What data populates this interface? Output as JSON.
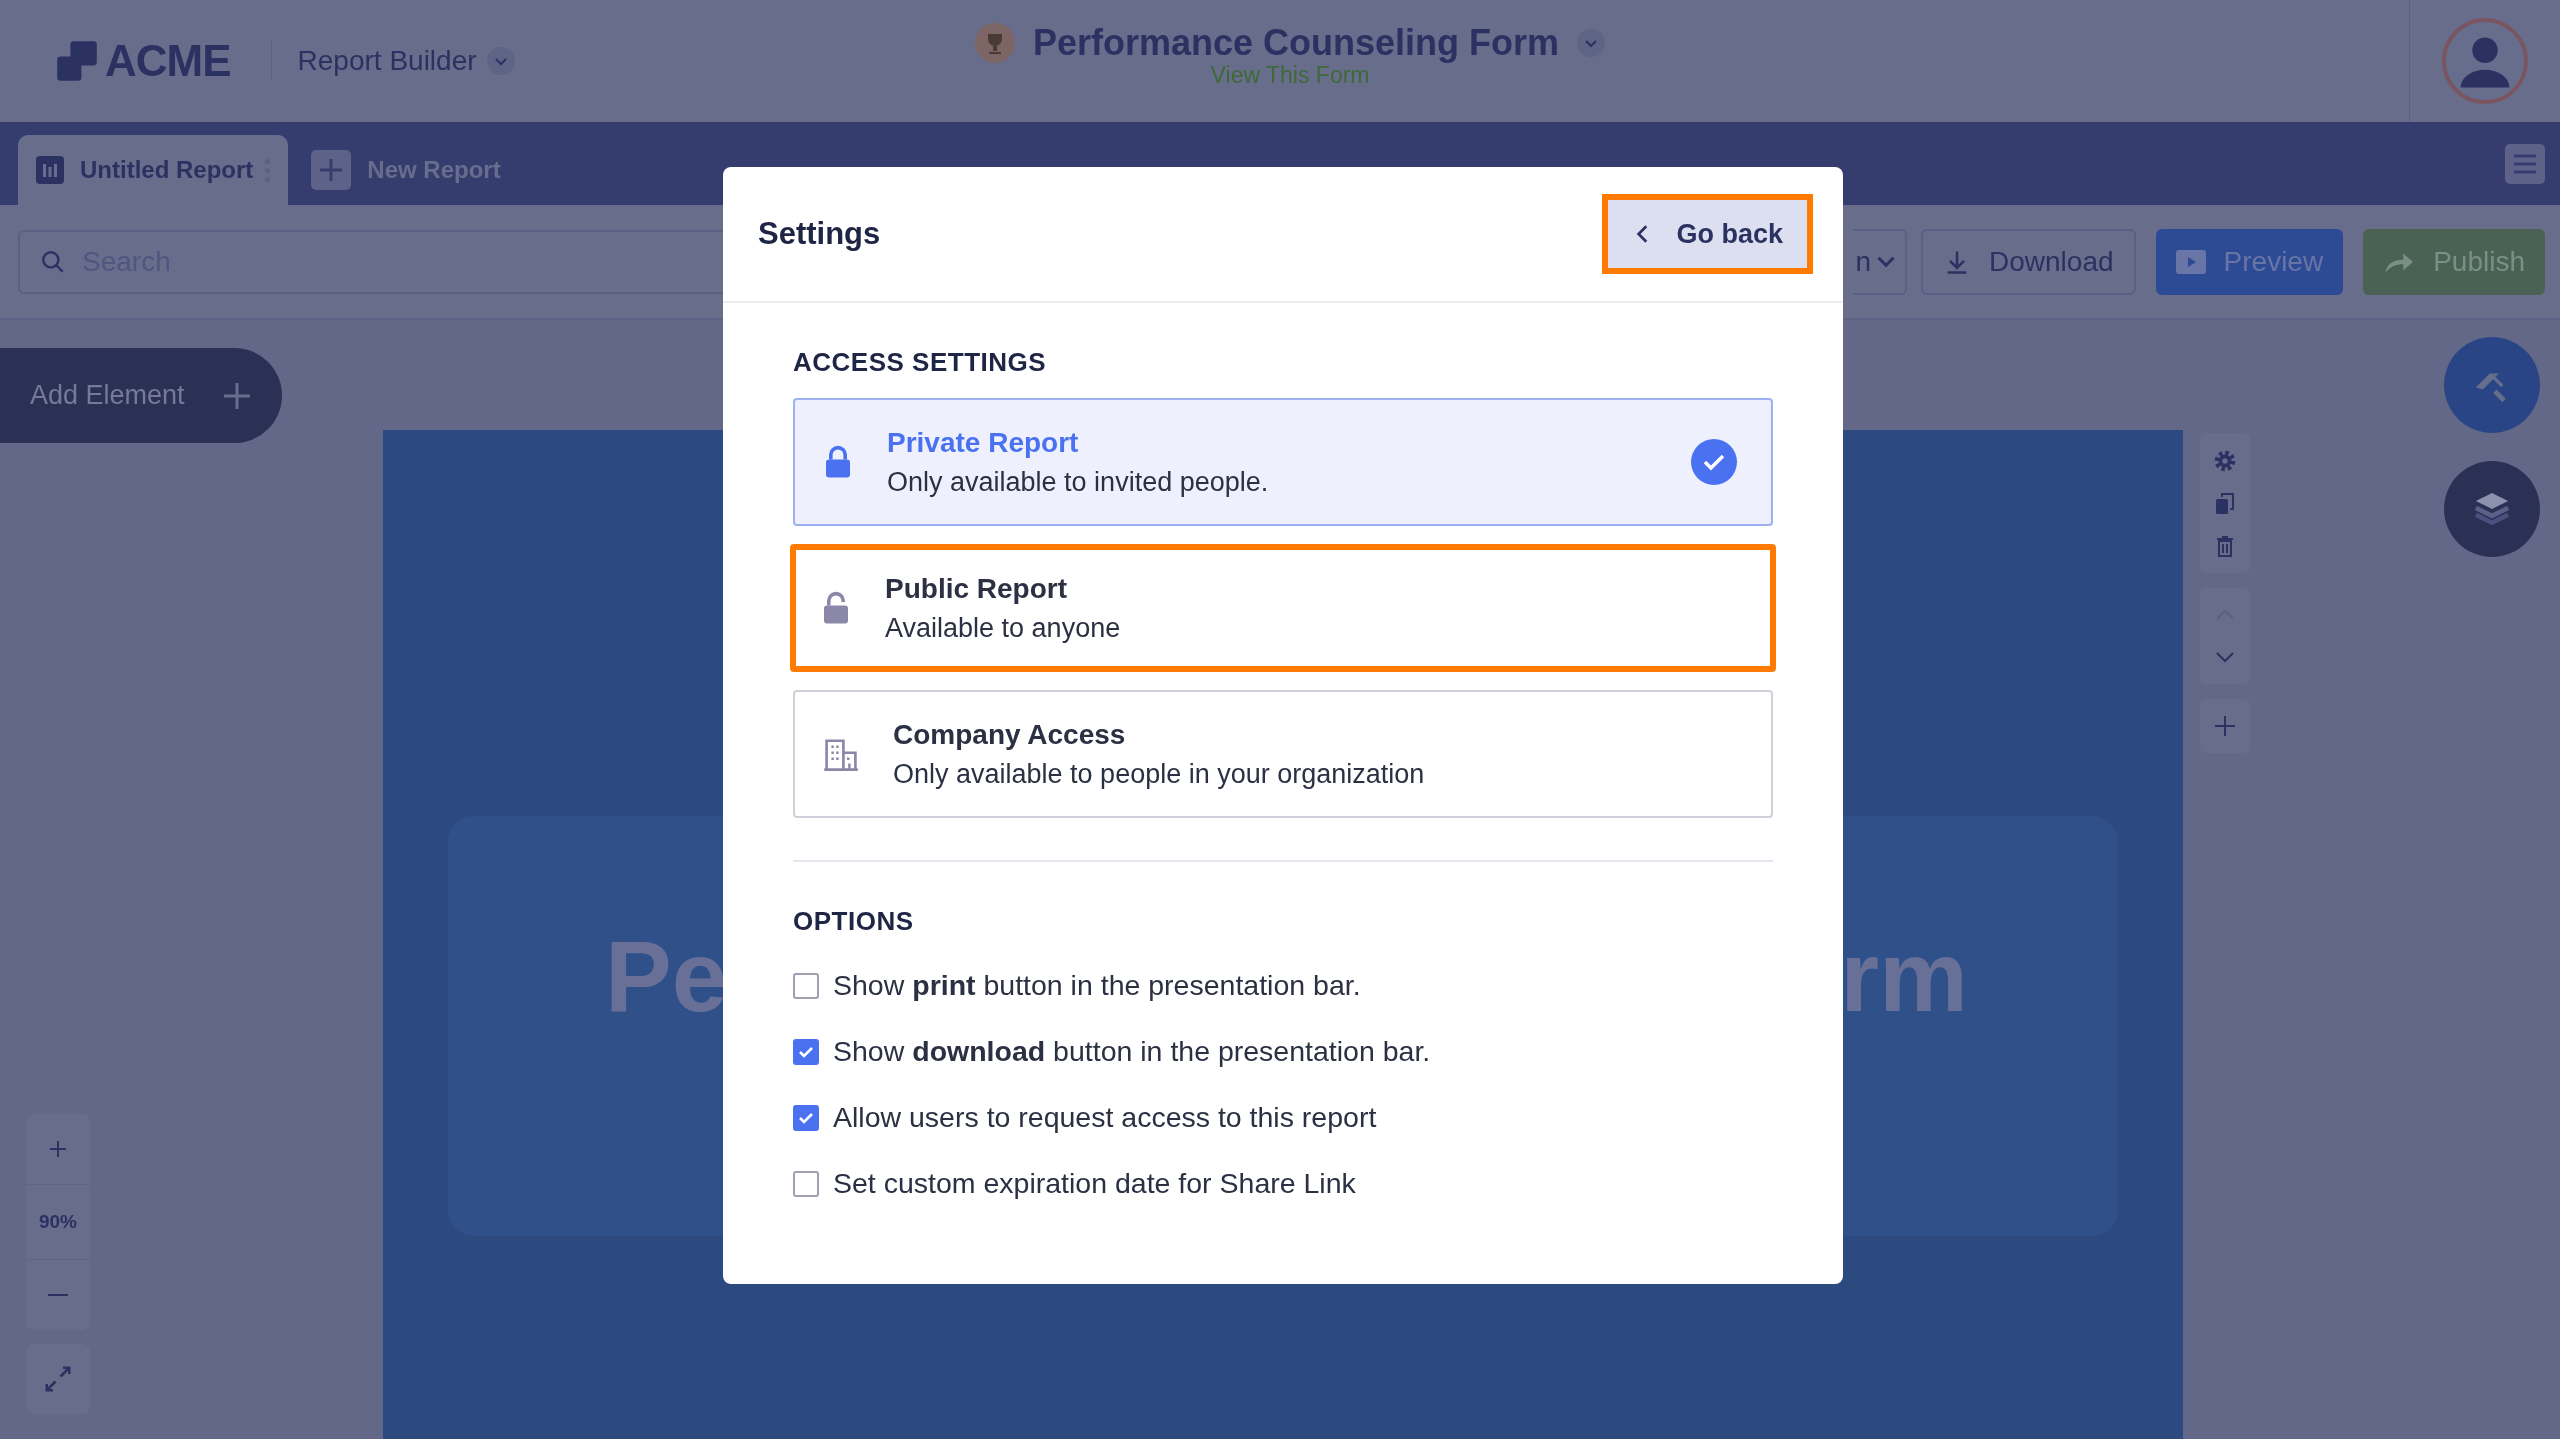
{
  "header": {
    "logo": "ACME",
    "app_menu": "Report Builder",
    "form_title": "Performance Counseling Form",
    "form_link": "View This Form"
  },
  "tabs": [
    {
      "label": "Untitled Report",
      "selected": true
    },
    {
      "label": "New Report",
      "selected": false
    }
  ],
  "search": {
    "placeholder": "Search"
  },
  "toolbar": [
    {
      "kind": "dropdown",
      "label": "n"
    },
    {
      "kind": "download",
      "label": "Download"
    },
    {
      "kind": "preview",
      "label": "Preview"
    },
    {
      "kind": "publish",
      "label": "Publish"
    }
  ],
  "add_element": "Add Element",
  "zoom": "90%",
  "canvas_title": [
    "Pe",
    "rm"
  ],
  "modal": {
    "title": "Settings",
    "go_back": {
      "label": "Go back",
      "highlighted": true
    },
    "access_heading": "ACCESS SETTINGS",
    "access_options": [
      {
        "kind": "lock",
        "title": "Private Report",
        "description": "Only available to invited people.",
        "selected": true,
        "highlighted": false
      },
      {
        "kind": "unlock",
        "title": "Public Report",
        "description": "Available to anyone",
        "selected": false,
        "highlighted": true
      },
      {
        "kind": "building",
        "title": "Company Access",
        "description": "Only available to people in your organization",
        "selected": false,
        "highlighted": false
      }
    ],
    "options_heading": "OPTIONS",
    "options": [
      {
        "text": "Show **print** button in the presentation bar.",
        "checked": false
      },
      {
        "text": "Show **download** button in the presentation bar.",
        "checked": true
      },
      {
        "text": "Allow users to request access to this report",
        "checked": true
      },
      {
        "text": "Set custom expiration date for Share Link",
        "checked": false
      }
    ]
  }
}
